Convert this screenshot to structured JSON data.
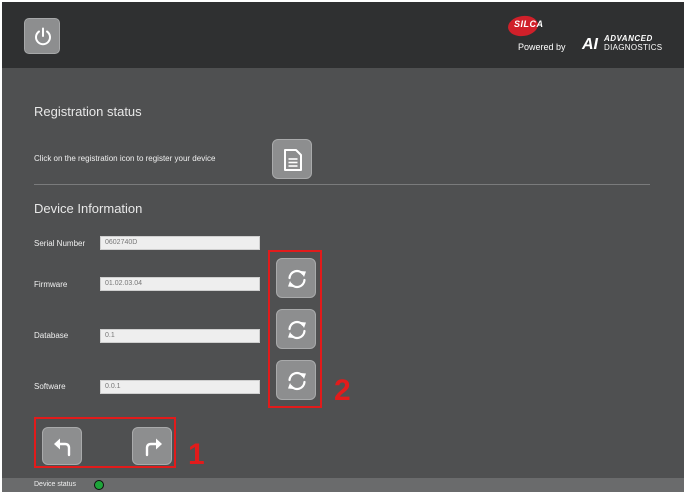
{
  "header": {
    "brand": {
      "name": "SILCA",
      "powered_by": "Powered by",
      "ai_mark": "AI",
      "advanced": "ADVANCED",
      "diagnostics": "DIAGNOSTICS"
    }
  },
  "registration": {
    "title": "Registration status",
    "instruction": "Click on the registration icon to register your device"
  },
  "device_info": {
    "title": "Device Information",
    "fields": [
      {
        "label": "Serial Number",
        "value": "0602740D"
      },
      {
        "label": "Firmware",
        "value": "01.02.03.04"
      },
      {
        "label": "Database",
        "value": "0.1"
      },
      {
        "label": "Software",
        "value": "0.0.1"
      }
    ]
  },
  "annotations": {
    "nav_group_number": "1",
    "refresh_group_number": "2",
    "color": "#e21b1b"
  },
  "status": {
    "label": "Device status",
    "indicator_color": "#1ea43a"
  },
  "icons": {
    "power": "power-icon",
    "registration": "document-icon",
    "refresh": "refresh-icon",
    "back": "back-arrow-icon",
    "forward": "forward-arrow-icon"
  }
}
